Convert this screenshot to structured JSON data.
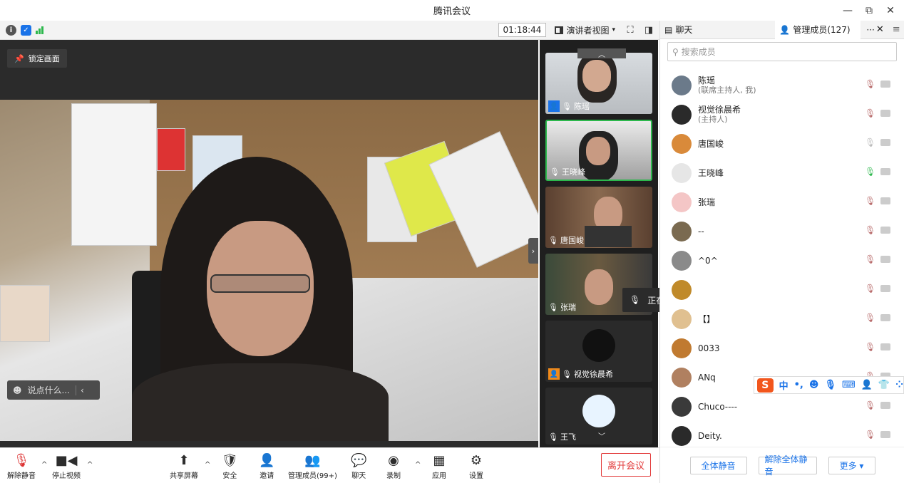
{
  "window": {
    "title": "腾讯会议"
  },
  "toolbar": {
    "timer": "01:18:44",
    "view_label": "演讲者视图"
  },
  "stage": {
    "lock_label": "锁定画面",
    "chat_placeholder": "说点什么..."
  },
  "thumbnails": [
    {
      "name": "陈瑶"
    },
    {
      "name": "王晓峰"
    },
    {
      "name": "唐国峻"
    },
    {
      "name": "张瑞"
    },
    {
      "name": "视觉徐晨希"
    },
    {
      "name": "王飞"
    }
  ],
  "speaking": {
    "text": "正在讲话: 王晓峰;"
  },
  "bottombar": {
    "unmute": "解除静音",
    "stop_video": "停止视频",
    "share": "共享屏幕",
    "security": "安全",
    "invite": "邀请",
    "members": "管理成员(99+)",
    "chat": "聊天",
    "record": "录制",
    "apps": "应用",
    "settings": "设置",
    "leave": "离开会议"
  },
  "panel": {
    "chat_tab": "聊天",
    "members_tab": "管理成员(127)",
    "search_placeholder": "搜索成员",
    "members": [
      {
        "name": "陈瑶",
        "role": "(联席主持人, 我)",
        "avatar": "#6b7a8a"
      },
      {
        "name": "视觉徐晨希",
        "role": "(主持人)",
        "avatar": "#2a2a2a"
      },
      {
        "name": "唐国峻",
        "role": "",
        "avatar": "#d98a3a"
      },
      {
        "name": "王晓峰",
        "role": "",
        "avatar": "#e6e6e6"
      },
      {
        "name": "张瑞",
        "role": "",
        "avatar": "#f4c6c6"
      },
      {
        "name": "--",
        "role": "",
        "avatar": "#7a6a50"
      },
      {
        "name": "^0^",
        "role": "",
        "avatar": "#8a8a8a"
      },
      {
        "name": "",
        "role": "",
        "avatar": "#c08a2a"
      },
      {
        "name": "【】",
        "role": "",
        "avatar": "#e0c090"
      },
      {
        "name": "0033",
        "role": "",
        "avatar": "#c07a30"
      },
      {
        "name": "ANq",
        "role": "",
        "avatar": "#b08060"
      },
      {
        "name": "Chuco----",
        "role": "",
        "avatar": "#3a3a3a"
      },
      {
        "name": "Deity.",
        "role": "",
        "avatar": "#2a2a2a"
      }
    ],
    "mute_all": "全体静音",
    "unmute_all": "解除全体静音",
    "more": "更多 ▾"
  },
  "ime": {
    "lang": "中"
  }
}
